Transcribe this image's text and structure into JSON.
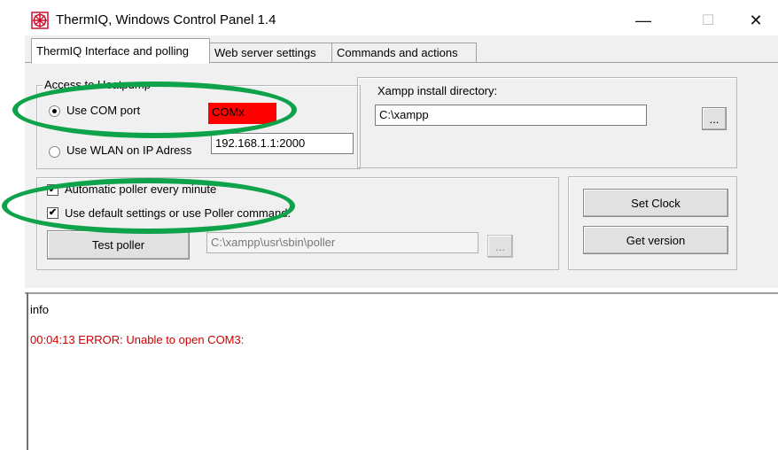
{
  "window": {
    "title": "ThermIQ, Windows Control Panel 1.4",
    "icon": "thermiq-logo-icon",
    "controls": {
      "minimize": "—",
      "maximize": "☐",
      "close": "✕"
    }
  },
  "tabs": [
    {
      "label": "ThermIQ Interface and polling",
      "active": true
    },
    {
      "label": "Web server settings",
      "active": false
    },
    {
      "label": "Commands and actions",
      "active": false
    }
  ],
  "access": {
    "group_label": "Access to Heatpump",
    "com_label": "Use COM port",
    "com_selected": true,
    "com_value": "COMx",
    "com_value_color": "#ff0000",
    "wlan_label": "Use WLAN on IP Adress",
    "wlan_value": "192.168.1.1:2000"
  },
  "xampp": {
    "label": "Xampp install directory:",
    "value": "C:\\xampp",
    "browse_label": "..."
  },
  "poller": {
    "auto_label": "Automatic poller every minute",
    "auto_checked": true,
    "default_label": "Use default settings or use  Poller command:",
    "default_checked": true,
    "test_button": "Test poller",
    "path_value": "C:\\xampp\\usr\\sbin\\poller",
    "browse_label": "..."
  },
  "actions": {
    "set_clock": "Set Clock",
    "get_version": "Get version"
  },
  "info": {
    "label": "info",
    "message": "00:04:13 ERROR: Unable to open COM3:",
    "message_color": "#cc0000"
  },
  "highlight_color": "#0ea34a"
}
